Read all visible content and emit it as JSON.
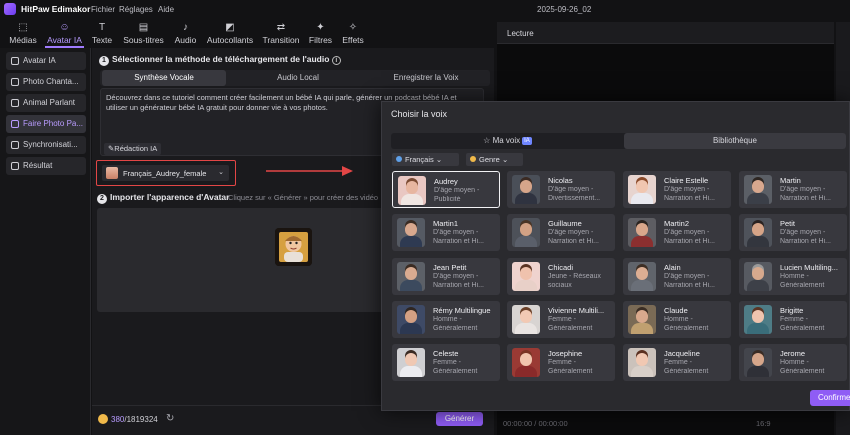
{
  "titlebar": {
    "app_name": "HitPaw Edimakor",
    "menus": [
      "Fichier",
      "Réglages",
      "Aide"
    ],
    "doc_title": "2025-09-26_02"
  },
  "toolbar": {
    "items": [
      {
        "label": "Médias",
        "icon": "media-icon"
      },
      {
        "label": "Avatar IA",
        "icon": "avatar-icon",
        "active": true
      },
      {
        "label": "Texte",
        "icon": "text-icon"
      },
      {
        "label": "Sous-titres",
        "icon": "subtitles-icon"
      },
      {
        "label": "Audio",
        "icon": "music-note-icon"
      },
      {
        "label": "Autocollants",
        "icon": "sticker-icon"
      },
      {
        "label": "Transition",
        "icon": "transition-icon"
      },
      {
        "label": "Filtres",
        "icon": "filter-icon"
      },
      {
        "label": "Effets",
        "icon": "effects-icon"
      }
    ]
  },
  "sidebar": {
    "items": [
      {
        "label": "Avatar IA"
      },
      {
        "label": "Photo Chanta..."
      },
      {
        "label": "Animal Parlant"
      },
      {
        "label": "Faire Photo Pa...",
        "active": true
      },
      {
        "label": "Synchronisati..."
      },
      {
        "label": "Résultat"
      }
    ]
  },
  "main": {
    "step1_number": "1",
    "step1_title": "Sélectionner la méthode de téléchargement de l'audio",
    "step1_info": "i",
    "tabs": [
      "Synthèse Vocale",
      "Audio Local",
      "Enregistrer la Voix"
    ],
    "description": "Découvrez dans ce tutoriel comment créer facilement un bébé IA qui parle, générer un podcast bébé IA et utiliser un générateur bébé IA gratuit pour donner vie à vos photos.",
    "redaction_label": "Rédaction IA",
    "voice_selected": "Français_Audrey_female",
    "step2_number": "2",
    "step2_title": "Importer l'apparence d'Avatar",
    "step2_hint": "Cliquez sur « Générer » pour créer des vidéo",
    "credits_used": "380",
    "credits_total": "/1819324",
    "generate_label": "Générer"
  },
  "preview": {
    "title": "Lecture",
    "timecode": "00:00:00 / 00:00:00",
    "aspect": "16:9"
  },
  "dialog": {
    "title": "Choisir la voix",
    "tabs": [
      {
        "label": "Ma voix",
        "badge": "IA"
      },
      {
        "label": "Bibliothèque",
        "active": true
      }
    ],
    "filters": [
      {
        "label": "Français",
        "icon": "globe-icon"
      },
      {
        "label": "Genre",
        "icon": "gender-icon"
      }
    ],
    "confirm_label": "Confirmer",
    "voices": [
      {
        "name": "Audrey",
        "d1": "D'âge moyen -",
        "d2": "Publicité",
        "selected": true,
        "skin": "#e7b6a0",
        "hair": "#7a4a32",
        "shirt": "#f0e6e2",
        "bg": "#e9c7c2"
      },
      {
        "name": "Nicolas",
        "d1": "D'âge moyen -",
        "d2": "Divertissement...",
        "skin": "#d6a58a",
        "hair": "#3b2a22",
        "shirt": "#2f3340",
        "bg": "#4a4f58"
      },
      {
        "name": "Claire Estelle",
        "d1": "D'âge moyen -",
        "d2": "Narration et Hi...",
        "skin": "#f0c6b0",
        "hair": "#8a4a2a",
        "shirt": "#e9e9ef",
        "bg": "#e7d4cf"
      },
      {
        "name": "Martin",
        "d1": "D'âge moyen -",
        "d2": "Narration et Hi...",
        "skin": "#d8a88e",
        "hair": "#2e2622",
        "shirt": "#3b3f48",
        "bg": "#5b5f66"
      },
      {
        "name": "Martin1",
        "d1": "D'âge moyen -",
        "d2": "Narration et Hi...",
        "skin": "#d8a88e",
        "hair": "#3a2c24",
        "shirt": "#2e3a52",
        "bg": "#555a63"
      },
      {
        "name": "Guillaume",
        "d1": "D'âge moyen -",
        "d2": "Narration et Hi...",
        "skin": "#d3a285",
        "hair": "#4a3526",
        "shirt": "#5a5f6a",
        "bg": "#4d5159"
      },
      {
        "name": "Martin2",
        "d1": "D'âge moyen -",
        "d2": "Narration et Hi...",
        "skin": "#d9a78b",
        "hair": "#2b2420",
        "shirt": "#8b2f2f",
        "bg": "#5d5d62"
      },
      {
        "name": "Petit",
        "d1": "D'âge moyen -",
        "d2": "Narration et Hi...",
        "skin": "#d6a487",
        "hair": "#2a2220",
        "shirt": "#33363e",
        "bg": "#4f535b"
      },
      {
        "name": "Jean Petit",
        "d1": "D'âge moyen -",
        "d2": "Narration et Hi...",
        "skin": "#d9ab90",
        "hair": "#3a2b22",
        "shirt": "#3c4a5e",
        "bg": "#5c6067"
      },
      {
        "name": "Chicadi",
        "d1": "Jeune - Réseaux",
        "d2": "sociaux",
        "skin": "#f0c2ad",
        "hair": "#5a3322",
        "shirt": "#e8d0c8",
        "bg": "#efd3ce"
      },
      {
        "name": "Alain",
        "d1": "D'âge moyen -",
        "d2": "Narration et Hi...",
        "skin": "#dcae93",
        "hair": "#3d2e24",
        "shirt": "#6a6f78",
        "bg": "#60646b"
      },
      {
        "name": "Lucien Multiling...",
        "d1": "Homme -",
        "d2": "Généralement",
        "skin": "#d7a98d",
        "hair": "#9a9a9a",
        "shirt": "#3d4048",
        "bg": "#575a61"
      },
      {
        "name": "Rémy Multilingue",
        "d1": "Homme -",
        "d2": "Généralement",
        "skin": "#d4a083",
        "hair": "#2f2622",
        "shirt": "#2c3852",
        "bg": "#3e4a66"
      },
      {
        "name": "Vivienne Multili...",
        "d1": "Femme -",
        "d2": "Généralement",
        "skin": "#f2c9b4",
        "hair": "#6b4028",
        "shirt": "#e9e4e2",
        "bg": "#d8d4d2"
      },
      {
        "name": "Claude",
        "d1": "Homme -",
        "d2": "Généralement",
        "skin": "#d9a98d",
        "hair": "#3b2d24",
        "shirt": "#c0a070",
        "bg": "#7a6a55"
      },
      {
        "name": "Brigitte",
        "d1": "Femme -",
        "d2": "Généralement",
        "skin": "#efc4ae",
        "hair": "#5a3524",
        "shirt": "#3a6d7a",
        "bg": "#4e7c86"
      },
      {
        "name": "Celeste",
        "d1": "Femme -",
        "d2": "Généralement",
        "skin": "#f0c8b3",
        "hair": "#3a2a22",
        "shirt": "#ececf0",
        "bg": "#cfcfd2"
      },
      {
        "name": "Josephine",
        "d1": "Femme -",
        "d2": "Généralement",
        "skin": "#f1c5ae",
        "hair": "#7a3424",
        "shirt": "#8a2a2a",
        "bg": "#9a3a34"
      },
      {
        "name": "Jacqueline",
        "d1": "Femme -",
        "d2": "Généralement",
        "skin": "#f1c8b2",
        "hair": "#5a3020",
        "shirt": "#d8cfc8",
        "bg": "#cbc2bb"
      },
      {
        "name": "Jerome",
        "d1": "Homme -",
        "d2": "Généralement",
        "skin": "#d6a68a",
        "hair": "#3a2c24",
        "shirt": "#2f3037",
        "bg": "#43454c"
      }
    ]
  }
}
